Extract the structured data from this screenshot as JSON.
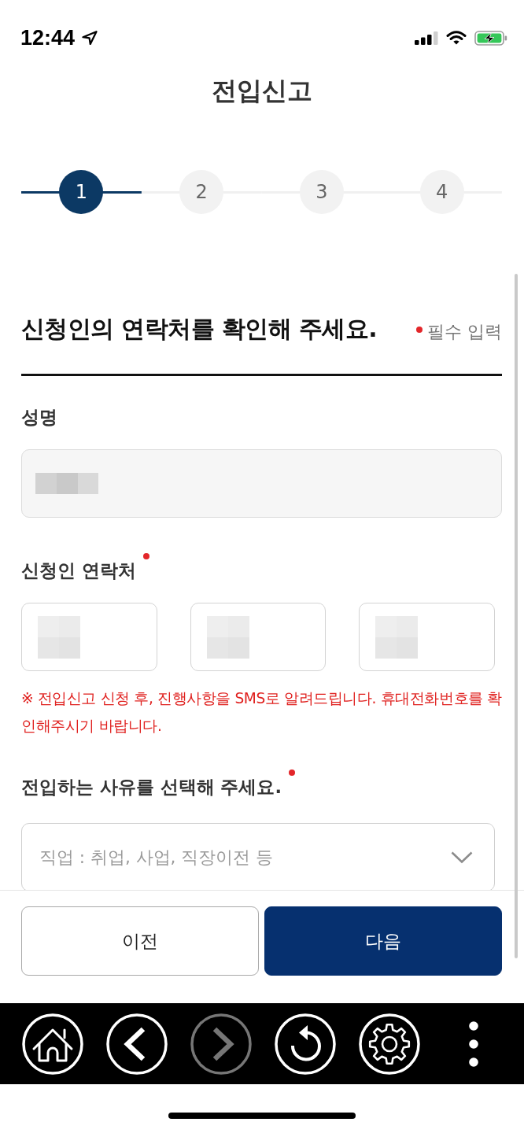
{
  "status_bar": {
    "time": "12:44"
  },
  "header": {
    "title": "전입신고"
  },
  "steps": [
    {
      "label": "1",
      "selected": true
    },
    {
      "label": "2",
      "selected": false
    },
    {
      "label": "3",
      "selected": false
    },
    {
      "label": "4",
      "selected": false
    }
  ],
  "form": {
    "heading": "신청인의 연락처를 확인해 주세요.",
    "required_note": "필수 입력",
    "fields": [
      {
        "kind": "readonly",
        "label": "성명",
        "required": false,
        "inputs": [
          {
            "redacted": true
          }
        ]
      },
      {
        "kind": "phone",
        "label": "신청인 연락처",
        "required": true,
        "inputs": [
          {
            "redacted": true
          },
          {
            "redacted": true
          },
          {
            "redacted": true
          }
        ],
        "notice": "※ 전입신고 신청 후, 진행사항을 SMS로 알려드립니다. 휴대전화번호를 확인해주시기 바랍니다."
      },
      {
        "kind": "select",
        "label": "전입하는 사유를 선택해 주세요.",
        "required": true,
        "inputs": [
          {
            "placeholder": "직업 : 취업, 사업, 직장이전 등"
          }
        ]
      }
    ]
  },
  "buttons": [
    {
      "label": "이전",
      "kind": "secondary"
    },
    {
      "label": "다음",
      "kind": "primary"
    }
  ],
  "toolbar": [
    {
      "kind": "home",
      "disabled": false
    },
    {
      "kind": "back",
      "disabled": false
    },
    {
      "kind": "forward",
      "disabled": true
    },
    {
      "kind": "refresh",
      "disabled": false
    },
    {
      "kind": "settings",
      "disabled": false
    },
    {
      "kind": "more",
      "disabled": false
    }
  ]
}
